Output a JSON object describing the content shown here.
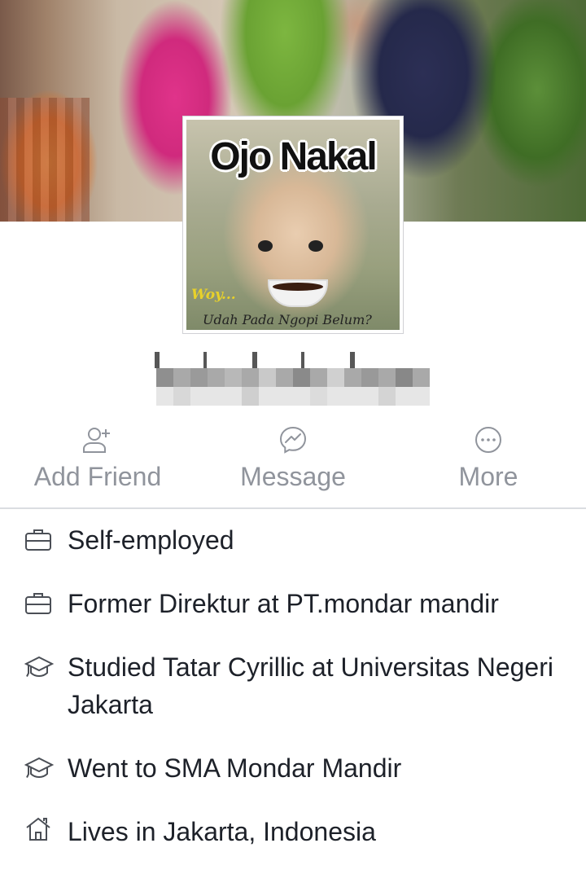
{
  "cover": {
    "description_icon": "cover-photo"
  },
  "profile": {
    "picture": {
      "title": "Ojo Nakal",
      "subtitle_1": "Woy...",
      "subtitle_2": "Udah Pada Ngopi Belum?"
    }
  },
  "actions": [
    {
      "label": "Add Friend",
      "icon": "add-friend-icon"
    },
    {
      "label": "Message",
      "icon": "messenger-icon"
    },
    {
      "label": "More",
      "icon": "more-icon"
    }
  ],
  "about": [
    {
      "icon": "briefcase-icon",
      "text": "Self-employed"
    },
    {
      "icon": "briefcase-icon",
      "text": "Former Direktur at PT.mondar mandir"
    },
    {
      "icon": "graduation-cap-icon",
      "text": "Studied Tatar Cyrillic at Universitas Negeri Jakarta"
    },
    {
      "icon": "graduation-cap-icon",
      "text": "Went to SMA Mondar Mandir"
    },
    {
      "icon": "home-icon",
      "text": "Lives in Jakarta, Indonesia"
    }
  ],
  "colors": {
    "muted": "#90949c",
    "text": "#1d2129",
    "divider": "#dadde1"
  }
}
